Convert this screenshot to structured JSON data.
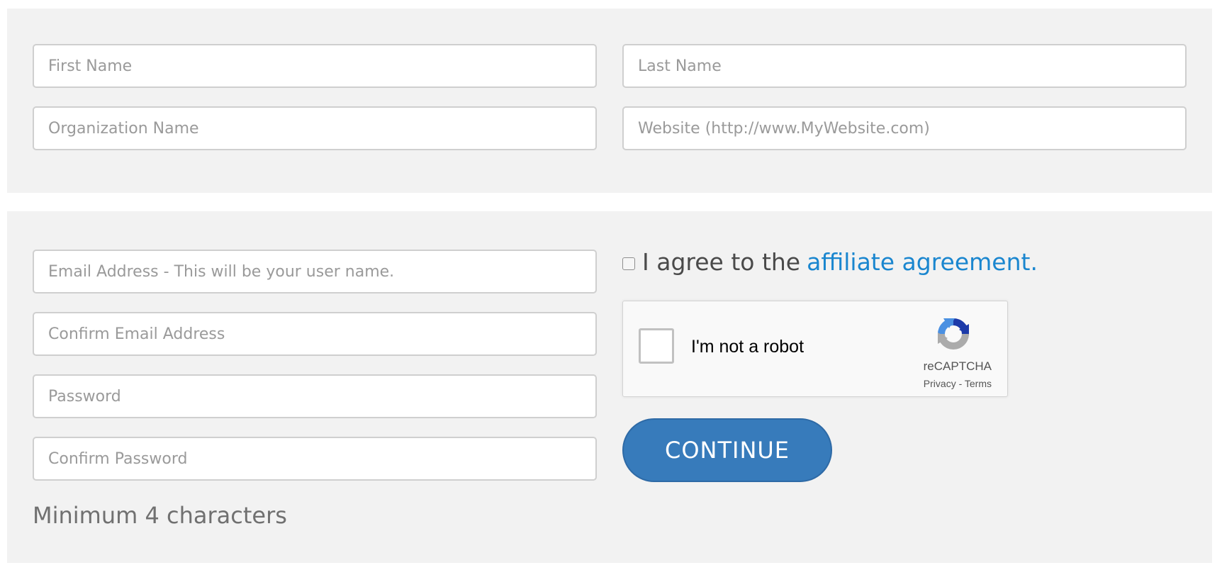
{
  "profile_section": {
    "first_name": {
      "value": "",
      "placeholder": "First Name"
    },
    "last_name": {
      "value": "",
      "placeholder": "Last Name"
    },
    "organization_name": {
      "value": "",
      "placeholder": "Organization Name"
    },
    "website": {
      "value": "",
      "placeholder": "Website (http://www.MyWebsite.com)"
    }
  },
  "account_section": {
    "email": {
      "value": "",
      "placeholder": "Email Address - This will be your user name."
    },
    "confirm_email": {
      "value": "",
      "placeholder": "Confirm Email Address"
    },
    "password": {
      "value": "",
      "placeholder": "Password"
    },
    "confirm_password": {
      "value": "",
      "placeholder": "Confirm Password"
    },
    "password_hint": "Minimum 4 characters"
  },
  "agreement": {
    "checked": false,
    "text": "I agree to the",
    "link_text": "affiliate agreement."
  },
  "captcha": {
    "label": "I'm not a robot",
    "brand": "reCAPTCHA",
    "legal": "Privacy - Terms",
    "icon": "recaptcha-logo-icon"
  },
  "continue_button": {
    "label": "CONTINUE"
  },
  "colors": {
    "panel_background": "#f2f2f2",
    "link": "#1a86cf",
    "button": "#377bbb",
    "placeholder": "#9a9a9a"
  }
}
